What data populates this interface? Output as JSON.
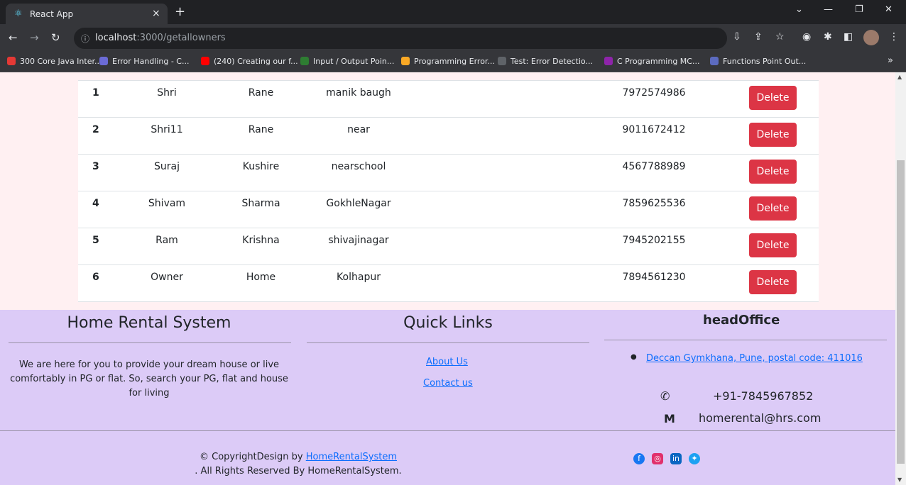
{
  "browser": {
    "tab_title": "React App",
    "tab_close": "×",
    "new_tab": "+",
    "url_host": "localhost",
    "url_path": ":3000/getallowners"
  },
  "bookmarks": [
    {
      "label": "300 Core Java Inter...",
      "color": "#e53935"
    },
    {
      "label": "Error Handling - C...",
      "color": "#6b6bd6"
    },
    {
      "label": "(240) Creating our f...",
      "color": "#ff0000"
    },
    {
      "label": "Input / Output Poin...",
      "color": "#2e7d32"
    },
    {
      "label": "Programming Error...",
      "color": "#f9a825"
    },
    {
      "label": "Test: Error Detectio...",
      "color": "#5f6368"
    },
    {
      "label": "C Programming MC...",
      "color": "#8e24aa"
    },
    {
      "label": "Functions Point Out...",
      "color": "#5c6bc0"
    }
  ],
  "bookmarks_more": "»",
  "owners": [
    {
      "id": "1",
      "first": "Shri",
      "last": "Rane",
      "address": "manik baugh",
      "phone": "7972574986",
      "action": "Delete"
    },
    {
      "id": "2",
      "first": "Shri11",
      "last": "Rane",
      "address": "near",
      "phone": "9011672412",
      "action": "Delete"
    },
    {
      "id": "3",
      "first": "Suraj",
      "last": "Kushire",
      "address": "nearschool",
      "phone": "4567788989",
      "action": "Delete"
    },
    {
      "id": "4",
      "first": "Shivam",
      "last": "Sharma",
      "address": "GokhleNagar",
      "phone": "7859625536",
      "action": "Delete"
    },
    {
      "id": "5",
      "first": "Ram",
      "last": "Krishna",
      "address": "shivajinagar",
      "phone": "7945202155",
      "action": "Delete"
    },
    {
      "id": "6",
      "first": "Owner",
      "last": "Home",
      "address": "Kolhapur",
      "phone": "7894561230",
      "action": "Delete"
    }
  ],
  "footer": {
    "about_title": "Home Rental System",
    "about_text": "We are here for you to provide your dream house or live comfortably in PG or flat. So, search your PG, flat and house for living",
    "links_title": "Quick Links",
    "link_about": "About Us",
    "link_contact": "Contact us",
    "office_title": "headOffice",
    "office_address": "Deccan Gymkhana, Pune, postal code: 411016",
    "phone": "+91-7845967852",
    "email": "homerental@hrs.com",
    "copyright_prefix": "© CopyrightDesign by ",
    "copyright_link": "HomeRentalSystem",
    "copyright_suffix": ". All Rights Reserved By HomeRentalSystem."
  },
  "colors": {
    "delete": "#dc3545",
    "footer_bg": "#dccbf7",
    "page_bg": "#fff0f2"
  }
}
